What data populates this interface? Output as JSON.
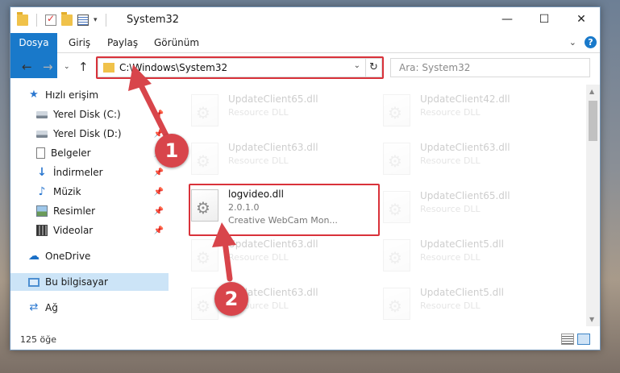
{
  "window": {
    "title": "System32",
    "caption": {
      "minimize": "—",
      "maximize": "☐",
      "close": "✕"
    }
  },
  "ribbon": {
    "tabs": [
      "Dosya",
      "Giriş",
      "Paylaş",
      "Görünüm"
    ],
    "help": "?"
  },
  "address": {
    "path": "C:\\Windows\\System32",
    "search_placeholder": "Ara: System32"
  },
  "nav": {
    "items": [
      {
        "label": "Hızlı erişim",
        "icon": "star-icon",
        "pinned": false,
        "selected": false
      },
      {
        "label": "Yerel Disk (C:)",
        "icon": "disk-icon",
        "pinned": true,
        "selected": false
      },
      {
        "label": "Yerel Disk (D:)",
        "icon": "disk-icon",
        "pinned": true,
        "selected": false
      },
      {
        "label": "Belgeler",
        "icon": "document-icon",
        "pinned": true,
        "selected": false
      },
      {
        "label": "İndirmeler",
        "icon": "download-icon",
        "pinned": true,
        "selected": false
      },
      {
        "label": "Müzik",
        "icon": "music-icon",
        "pinned": true,
        "selected": false
      },
      {
        "label": "Resimler",
        "icon": "pictures-icon",
        "pinned": true,
        "selected": false
      },
      {
        "label": "Videolar",
        "icon": "video-icon",
        "pinned": true,
        "selected": false
      },
      {
        "label": "OneDrive",
        "icon": "cloud-icon",
        "pinned": false,
        "selected": false
      },
      {
        "label": "Bu bilgisayar",
        "icon": "computer-icon",
        "pinned": false,
        "selected": true
      },
      {
        "label": "Ağ",
        "icon": "network-icon",
        "pinned": false,
        "selected": false
      }
    ]
  },
  "files": [
    {
      "name": "UpdateClient65.dll",
      "desc": "Resource DLL",
      "desc2": "",
      "faded": true
    },
    {
      "name": "UpdateClient42.dll",
      "desc": "Resource DLL",
      "desc2": "",
      "faded": true
    },
    {
      "name": "UpdateClient63.dll",
      "desc": "Resource DLL",
      "desc2": "",
      "faded": true
    },
    {
      "name": "UpdateClient63.dll",
      "desc": "Resource DLL",
      "desc2": "",
      "faded": true
    },
    {
      "name": "logvideo.dll",
      "desc": "2.0.1.0",
      "desc2": "Creative WebCam Mon...",
      "faded": false
    },
    {
      "name": "UpdateClient65.dll",
      "desc": "Resource DLL",
      "desc2": "",
      "faded": true
    },
    {
      "name": "UpdateClient63.dll",
      "desc": "Resource DLL",
      "desc2": "",
      "faded": true
    },
    {
      "name": "UpdateClient5.dll",
      "desc": "Resource DLL",
      "desc2": "",
      "faded": true
    },
    {
      "name": "UpdateClient63.dll",
      "desc": "Resource DLL",
      "desc2": "",
      "faded": true
    },
    {
      "name": "UpdateClient5.dll",
      "desc": "Resource DLL",
      "desc2": "",
      "faded": true
    }
  ],
  "status": {
    "count": "125 öğe"
  },
  "annotations": {
    "step1": "1",
    "step2": "2",
    "color": "#d8454b"
  }
}
